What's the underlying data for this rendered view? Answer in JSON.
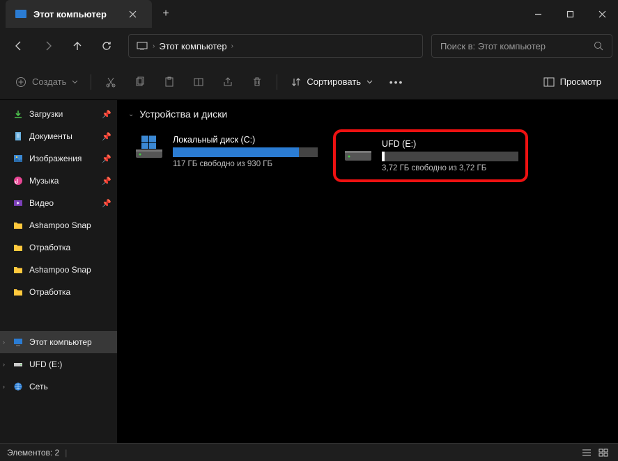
{
  "tab": {
    "title": "Этот компьютер"
  },
  "breadcrumb": {
    "location": "Этот компьютер"
  },
  "search": {
    "placeholder": "Поиск в: Этот компьютер"
  },
  "toolbar": {
    "create": "Создать",
    "sort": "Сортировать",
    "view": "Просмотр"
  },
  "sidebar": {
    "items": [
      {
        "label": "Загрузки",
        "pinned": true,
        "type": "downloads"
      },
      {
        "label": "Документы",
        "pinned": true,
        "type": "documents"
      },
      {
        "label": "Изображения",
        "pinned": true,
        "type": "pictures"
      },
      {
        "label": "Музыка",
        "pinned": true,
        "type": "music"
      },
      {
        "label": "Видео",
        "pinned": true,
        "type": "videos"
      },
      {
        "label": "Ashampoo Snap",
        "pinned": false,
        "type": "folder"
      },
      {
        "label": "Отработка",
        "pinned": false,
        "type": "folder"
      },
      {
        "label": "Ashampoo Snap",
        "pinned": false,
        "type": "folder"
      },
      {
        "label": "Отработка",
        "pinned": false,
        "type": "folder"
      }
    ],
    "tree": [
      {
        "label": "Этот компьютер",
        "type": "pc",
        "active": true,
        "expandable": true
      },
      {
        "label": "UFD (E:)",
        "type": "drive",
        "expandable": true
      },
      {
        "label": "Сеть",
        "type": "network",
        "expandable": true
      }
    ]
  },
  "content": {
    "group_title": "Устройства и диски",
    "drives": [
      {
        "name": "Локальный диск (C:)",
        "free_text": "117 ГБ свободно из 930 ГБ",
        "fill_pct": 87,
        "fill_color": "blue",
        "icon": "windrive",
        "highlight": false
      },
      {
        "name": "UFD (E:)",
        "free_text": "3,72 ГБ свободно из 3,72 ГБ",
        "fill_pct": 2,
        "fill_color": "white",
        "icon": "usbdrive",
        "highlight": true
      }
    ]
  },
  "statusbar": {
    "text": "Элементов: 2"
  }
}
